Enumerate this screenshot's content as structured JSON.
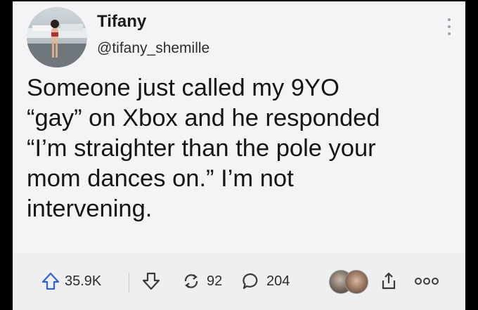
{
  "tweet": {
    "display_name": "Tifany",
    "handle": "@tifany_shemille",
    "text": "Someone just called my 9YO\n“gay” on Xbox and he responded\n“I’m straighter than the pole your\nmom dances on.” I’m not\nintervening."
  },
  "actions": {
    "upvotes": "35.9K",
    "reposts": "92",
    "comments": "204"
  },
  "icons": [
    "more-vertical-icon",
    "upvote-arrow-icon",
    "downvote-arrow-icon",
    "repost-icon",
    "comment-icon",
    "share-icon",
    "more-horizontal-icon"
  ],
  "colors": {
    "background": "#000000",
    "card": "#f4f4f6",
    "text": "#151515"
  }
}
